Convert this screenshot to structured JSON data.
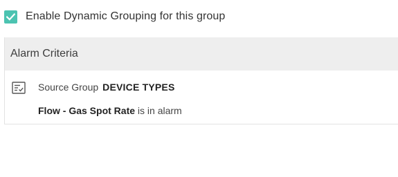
{
  "dynamic_grouping": {
    "checked": true,
    "label": "Enable Dynamic Grouping for this group",
    "checkbox_color": "#4cc3b1"
  },
  "alarm_criteria": {
    "title": "Alarm Criteria",
    "header_bg": "#eeeeee",
    "icon": "checklist-icon",
    "source_group_label": "Source Group",
    "source_group_value": "DEVICE TYPES",
    "condition_name": "Flow - Gas Spot Rate",
    "condition_text": "is in alarm"
  }
}
